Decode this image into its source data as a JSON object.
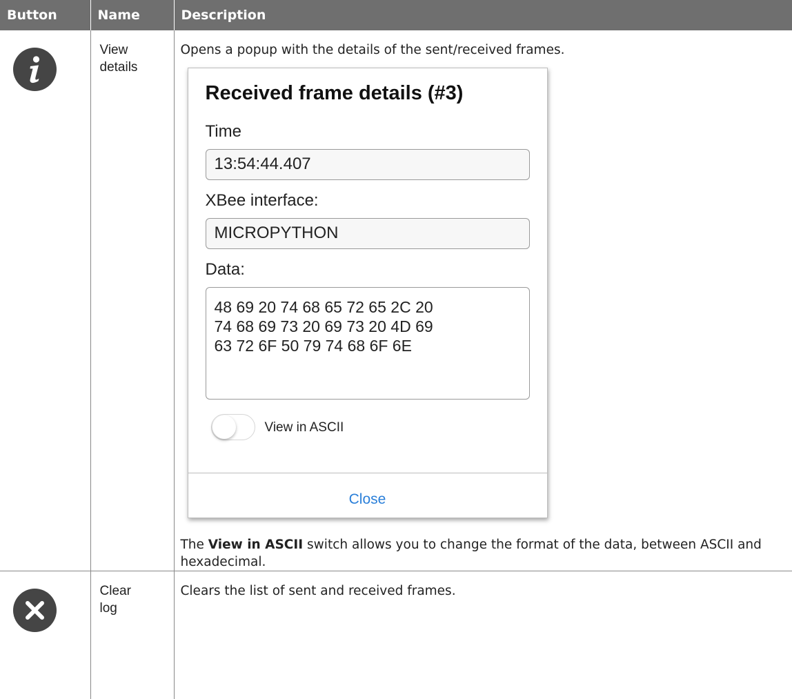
{
  "table": {
    "headers": {
      "button": "Button",
      "name": "Name",
      "description": "Description"
    },
    "rows": [
      {
        "icon": "info-icon",
        "name_line1": "View",
        "name_line2": "details",
        "description": "Opens a popup with the details of the sent/received frames.",
        "popup": {
          "title": "Received frame details (#3)",
          "time_label": "Time",
          "time_value": "13:54:44.407",
          "interface_label": "XBee interface:",
          "interface_value": "MICROPYTHON",
          "data_label": "Data:",
          "data_line1": "48 69 20 74 68 65 72 65 2C 20",
          "data_line2": "74 68 69 73 20 69 73 20 4D 69",
          "data_line3": "63 72 6F 50 79 74 68 6F 6E",
          "toggle_label": "View in ASCII",
          "toggle_on": false,
          "close_label": "Close",
          "close_color": "#2a7fd9"
        },
        "note_prefix": "The ",
        "note_bold": "View in ASCII",
        "note_suffix": " switch allows you to change the format of the data, between ASCII and hexadecimal."
      },
      {
        "icon": "close-circle-icon",
        "name_line1": "Clear",
        "name_line2": "log",
        "description": "Clears the list of sent and received frames."
      }
    ],
    "header_color": "#6f6f6f"
  }
}
